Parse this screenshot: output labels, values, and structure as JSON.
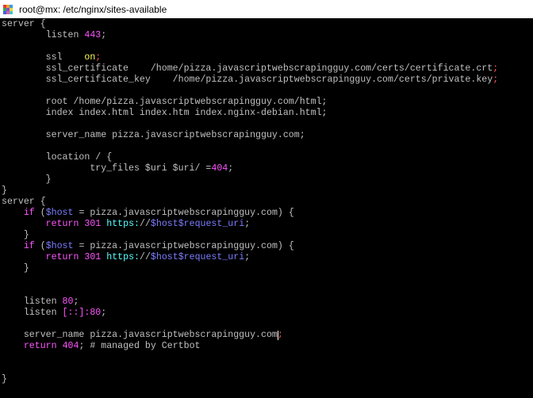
{
  "window": {
    "title": "root@mx: /etc/nginx/sites-available",
    "icon": "putty-terminal-icon"
  },
  "colors": {
    "background": "#000000",
    "text": "#c0c0c0",
    "keyword_magenta": "#ff55ff",
    "value_yellow": "#ffff55",
    "semicolon_red": "#ff5555",
    "variable_blue": "#7d7dff",
    "url_cyan": "#55ffff"
  },
  "terminal": {
    "lines": [
      [
        [
          "n",
          "server {"
        ]
      ],
      [
        [
          "n",
          "        listen "
        ],
        [
          "m",
          "443"
        ],
        [
          "n",
          ";"
        ]
      ],
      [],
      [
        [
          "n",
          "        ssl    "
        ],
        [
          "y",
          "on"
        ],
        [
          "r",
          ";"
        ]
      ],
      [
        [
          "n",
          "        ssl_certificate    /home/pizza.javascriptwebscrapingguy.com/certs/certificate.crt"
        ],
        [
          "r",
          ";"
        ]
      ],
      [
        [
          "n",
          "        ssl_certificate_key    /home/pizza.javascriptwebscrapingguy.com/certs/private.key"
        ],
        [
          "r",
          ";"
        ]
      ],
      [],
      [
        [
          "n",
          "        root /home/pizza.javascriptwebscrapingguy.com/html;"
        ]
      ],
      [
        [
          "n",
          "        index index.html index.htm index.nginx-debian.html;"
        ]
      ],
      [],
      [
        [
          "n",
          "        server_name pizza.javascriptwebscrapingguy.com;"
        ]
      ],
      [],
      [
        [
          "n",
          "        location / {"
        ]
      ],
      [
        [
          "n",
          "                try_files $uri $uri/ ="
        ],
        [
          "m",
          "404"
        ],
        [
          "n",
          ";"
        ]
      ],
      [
        [
          "n",
          "        }"
        ]
      ],
      [
        [
          "n",
          "}"
        ]
      ],
      [
        [
          "n",
          "server {"
        ]
      ],
      [
        [
          "n",
          "    "
        ],
        [
          "m",
          "if"
        ],
        [
          "n",
          " ("
        ],
        [
          "b",
          "$host"
        ],
        [
          "n",
          " = pizza.javascriptwebscrapingguy.com) {"
        ]
      ],
      [
        [
          "n",
          "        "
        ],
        [
          "m",
          "return"
        ],
        [
          "n",
          " "
        ],
        [
          "m",
          "301"
        ],
        [
          "n",
          " "
        ],
        [
          "c",
          "https:"
        ],
        [
          "n",
          "//"
        ],
        [
          "b",
          "$host$request_uri"
        ],
        [
          "n",
          ";"
        ]
      ],
      [
        [
          "n",
          "    }"
        ]
      ],
      [
        [
          "n",
          "    "
        ],
        [
          "m",
          "if"
        ],
        [
          "n",
          " ("
        ],
        [
          "b",
          "$host"
        ],
        [
          "n",
          " = pizza.javascriptwebscrapingguy.com) {"
        ]
      ],
      [
        [
          "n",
          "        "
        ],
        [
          "m",
          "return"
        ],
        [
          "n",
          " "
        ],
        [
          "m",
          "301"
        ],
        [
          "n",
          " "
        ],
        [
          "c",
          "https:"
        ],
        [
          "n",
          "//"
        ],
        [
          "b",
          "$host$request_uri"
        ],
        [
          "n",
          ";"
        ]
      ],
      [
        [
          "n",
          "    }"
        ]
      ],
      [],
      [],
      [
        [
          "n",
          "    listen "
        ],
        [
          "m",
          "80"
        ],
        [
          "n",
          ";"
        ]
      ],
      [
        [
          "n",
          "    listen "
        ],
        [
          "m",
          "[::]:"
        ],
        [
          "n",
          ""
        ],
        [
          "m",
          "80"
        ],
        [
          "n",
          ";"
        ]
      ],
      [],
      [
        [
          "n",
          "    server_name pizza.javascriptwebscrapingguy.com"
        ],
        [
          "cur",
          ""
        ],
        [
          "r",
          ";"
        ]
      ],
      [
        [
          "n",
          "    "
        ],
        [
          "m",
          "return"
        ],
        [
          "n",
          " "
        ],
        [
          "m",
          "404"
        ],
        [
          "n",
          "; # managed by Certbot"
        ]
      ],
      [],
      [],
      [
        [
          "n",
          "}"
        ]
      ]
    ]
  }
}
